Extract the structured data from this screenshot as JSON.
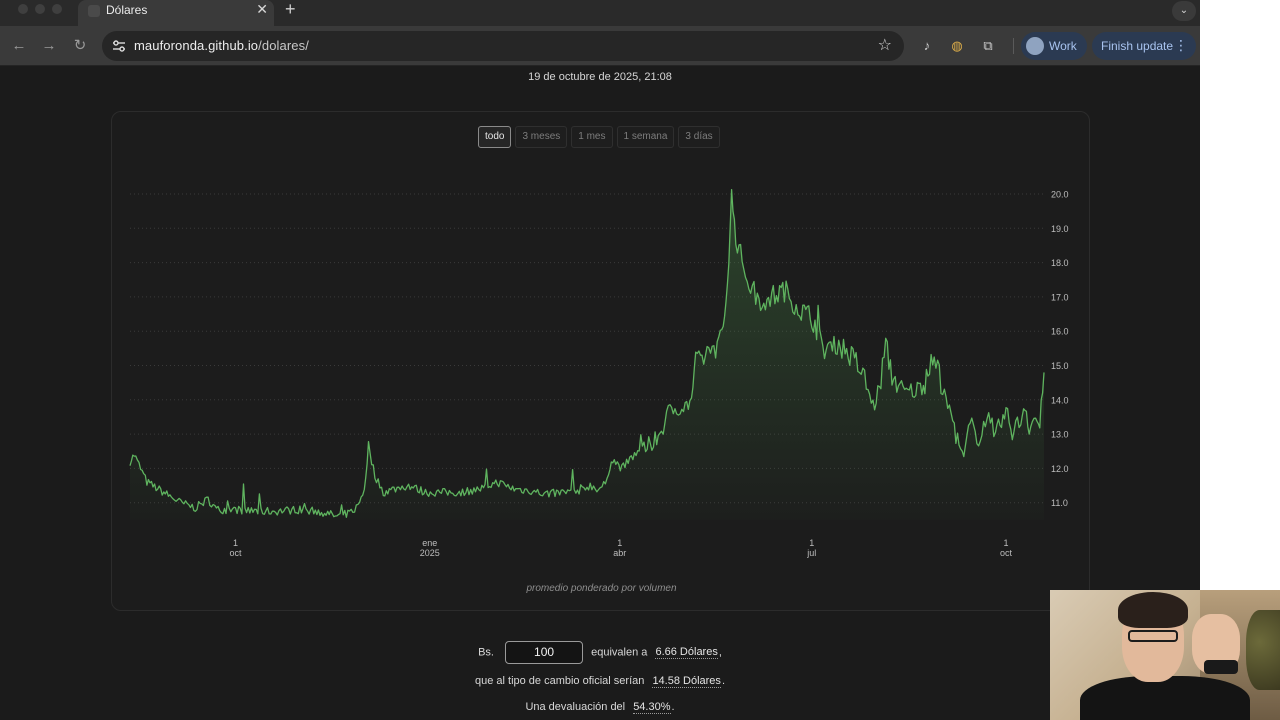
{
  "browser": {
    "tab_title": "Dólares",
    "tab_close": "✕",
    "new_tab": "+",
    "url_host": "mauforonda.github.io",
    "url_path": "/dolares/",
    "profile_label": "Work",
    "update_label": "Finish update",
    "icons": [
      "back-arrow-icon",
      "forward-arrow-icon",
      "reload-icon",
      "site-settings-icon",
      "bookmark-star-icon",
      "extension-icon",
      "puzzle-icon",
      "menu-icon"
    ]
  },
  "page": {
    "timestamp": "19 de octubre de 2025, 21:08",
    "ranges": [
      {
        "label": "todo",
        "active": true
      },
      {
        "label": "3 meses",
        "active": false
      },
      {
        "label": "1 mes",
        "active": false
      },
      {
        "label": "1 semana",
        "active": false
      },
      {
        "label": "3 días",
        "active": false
      }
    ],
    "caption": "promedio ponderado por volumen",
    "conversion": {
      "prefix": "Bs.",
      "amount": "100",
      "equivalent_text": "equivalen a",
      "equivalent_value": "6.66 Dólares",
      "official_text": "que al tipo de cambio oficial serían",
      "official_value": "14.58 Dólares",
      "devaluation_text": "Una devaluación del",
      "devaluation_value": "54.30%",
      "period": ".",
      "comma": ","
    }
  },
  "chart_data": {
    "type": "area",
    "title": "",
    "xlabel": "",
    "ylabel": "",
    "y_ticks": [
      "20.0",
      "19.0",
      "18.0",
      "17.0",
      "16.0",
      "15.0",
      "14.0",
      "13.0",
      "12.0",
      "11.0"
    ],
    "ylim": [
      10.5,
      20.2
    ],
    "x_ticks": [
      {
        "line1": "1",
        "line2": "oct",
        "date": "2024-10-01"
      },
      {
        "line1": "ene",
        "line2": "2025",
        "date": "2025-01-01"
      },
      {
        "line1": "1",
        "line2": "abr",
        "date": "2025-04-01"
      },
      {
        "line1": "1",
        "line2": "jul",
        "date": "2025-07-01"
      },
      {
        "line1": "1",
        "line2": "oct",
        "date": "2025-10-01"
      }
    ],
    "x_start": "2024-08-12",
    "x_end": "2025-10-19",
    "series": [
      {
        "color": "#5fb45f",
        "points": [
          [
            "2024-08-12",
            12.2
          ],
          [
            "2024-08-14",
            12.4
          ],
          [
            "2024-08-20",
            11.6
          ],
          [
            "2024-08-28",
            11.3
          ],
          [
            "2024-09-05",
            11.0
          ],
          [
            "2024-09-12",
            10.85
          ],
          [
            "2024-09-18",
            11.1
          ],
          [
            "2024-09-22",
            10.8
          ],
          [
            "2024-10-01",
            10.8
          ],
          [
            "2024-10-10",
            10.75
          ],
          [
            "2024-10-20",
            10.75
          ],
          [
            "2024-10-30",
            10.8
          ],
          [
            "2024-11-10",
            10.75
          ],
          [
            "2024-11-18",
            10.6
          ],
          [
            "2024-11-24",
            10.7
          ],
          [
            "2024-11-28",
            10.9
          ],
          [
            "2024-12-01",
            11.4
          ],
          [
            "2024-12-03",
            12.6
          ],
          [
            "2024-12-06",
            11.8
          ],
          [
            "2024-12-10",
            11.3
          ],
          [
            "2024-12-15",
            11.4
          ],
          [
            "2024-12-22",
            11.5
          ],
          [
            "2024-12-30",
            11.3
          ],
          [
            "2025-01-08",
            11.3
          ],
          [
            "2025-01-15",
            11.3
          ],
          [
            "2025-01-25",
            11.4
          ],
          [
            "2025-02-02",
            11.6
          ],
          [
            "2025-02-10",
            11.4
          ],
          [
            "2025-02-18",
            11.35
          ],
          [
            "2025-02-25",
            11.25
          ],
          [
            "2025-03-05",
            11.3
          ],
          [
            "2025-03-12",
            11.35
          ],
          [
            "2025-03-18",
            11.5
          ],
          [
            "2025-03-22",
            11.4
          ],
          [
            "2025-03-26",
            11.6
          ],
          [
            "2025-03-28",
            12.3
          ],
          [
            "2025-04-02",
            12.0
          ],
          [
            "2025-04-08",
            12.4
          ],
          [
            "2025-04-14",
            12.6
          ],
          [
            "2025-04-20",
            13.0
          ],
          [
            "2025-04-24",
            13.6
          ],
          [
            "2025-04-28",
            13.8
          ],
          [
            "2025-05-02",
            13.8
          ],
          [
            "2025-05-05",
            14.0
          ],
          [
            "2025-05-07",
            15.0
          ],
          [
            "2025-05-10",
            15.2
          ],
          [
            "2025-05-14",
            15.5
          ],
          [
            "2025-05-18",
            15.6
          ],
          [
            "2025-05-20",
            16.0
          ],
          [
            "2025-05-22",
            17.5
          ],
          [
            "2025-05-24",
            19.9
          ],
          [
            "2025-05-26",
            18.8
          ],
          [
            "2025-05-29",
            18.0
          ],
          [
            "2025-06-02",
            17.3
          ],
          [
            "2025-06-06",
            16.9
          ],
          [
            "2025-06-12",
            17.0
          ],
          [
            "2025-06-18",
            17.2
          ],
          [
            "2025-06-22",
            16.9
          ],
          [
            "2025-06-26",
            16.6
          ],
          [
            "2025-07-01",
            16.4
          ],
          [
            "2025-07-04",
            16.0
          ],
          [
            "2025-07-07",
            15.3
          ],
          [
            "2025-07-10",
            15.8
          ],
          [
            "2025-07-16",
            15.5
          ],
          [
            "2025-07-22",
            15.1
          ],
          [
            "2025-07-26",
            14.6
          ],
          [
            "2025-07-30",
            13.8
          ],
          [
            "2025-08-02",
            14.3
          ],
          [
            "2025-08-05",
            15.6
          ],
          [
            "2025-08-08",
            14.7
          ],
          [
            "2025-08-14",
            14.2
          ],
          [
            "2025-08-20",
            14.3
          ],
          [
            "2025-08-25",
            14.6
          ],
          [
            "2025-08-28",
            15.4
          ],
          [
            "2025-09-01",
            14.2
          ],
          [
            "2025-09-05",
            13.6
          ],
          [
            "2025-09-08",
            12.8
          ],
          [
            "2025-09-11",
            12.3
          ],
          [
            "2025-09-14",
            13.3
          ],
          [
            "2025-09-18",
            12.9
          ],
          [
            "2025-09-22",
            13.5
          ],
          [
            "2025-09-26",
            13.0
          ],
          [
            "2025-10-01",
            13.6
          ],
          [
            "2025-10-04",
            13.1
          ],
          [
            "2025-10-08",
            13.4
          ],
          [
            "2025-10-10",
            13.9
          ],
          [
            "2025-10-12",
            13.2
          ],
          [
            "2025-10-15",
            13.5
          ],
          [
            "2025-10-17",
            13.2
          ],
          [
            "2025-10-19",
            14.8
          ]
        ]
      }
    ],
    "grid": "horizontal dotted",
    "y_axis_position": "right"
  }
}
